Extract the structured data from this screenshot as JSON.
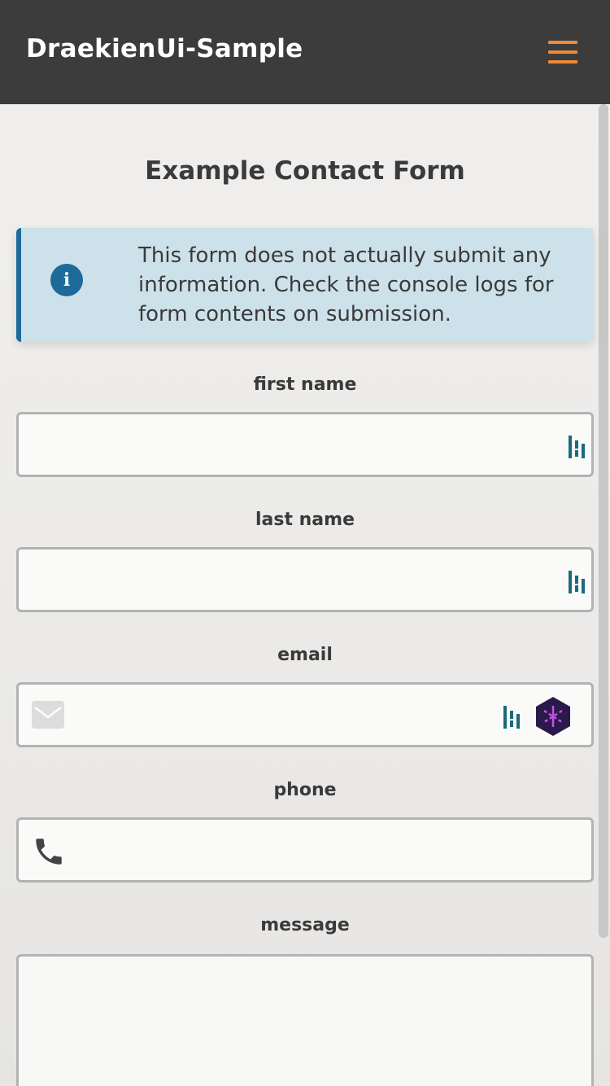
{
  "header": {
    "title": "DraekienUi-Sample",
    "menu_icon": "hamburger-menu-icon",
    "accent_color": "#ec8a3a"
  },
  "form": {
    "title": "Example Contact Form",
    "notice": {
      "icon": "info-icon",
      "icon_glyph": "i",
      "text": "This form does not actually submit any information. Check the console logs for form contents on submission."
    },
    "fields": {
      "first_name": {
        "label": "first name",
        "value": ""
      },
      "last_name": {
        "label": "last name",
        "value": ""
      },
      "email": {
        "label": "email",
        "value": "",
        "icon": "mail-icon"
      },
      "phone": {
        "label": "phone",
        "value": "",
        "icon": "phone-icon"
      },
      "message": {
        "label": "message",
        "value": ""
      }
    }
  }
}
